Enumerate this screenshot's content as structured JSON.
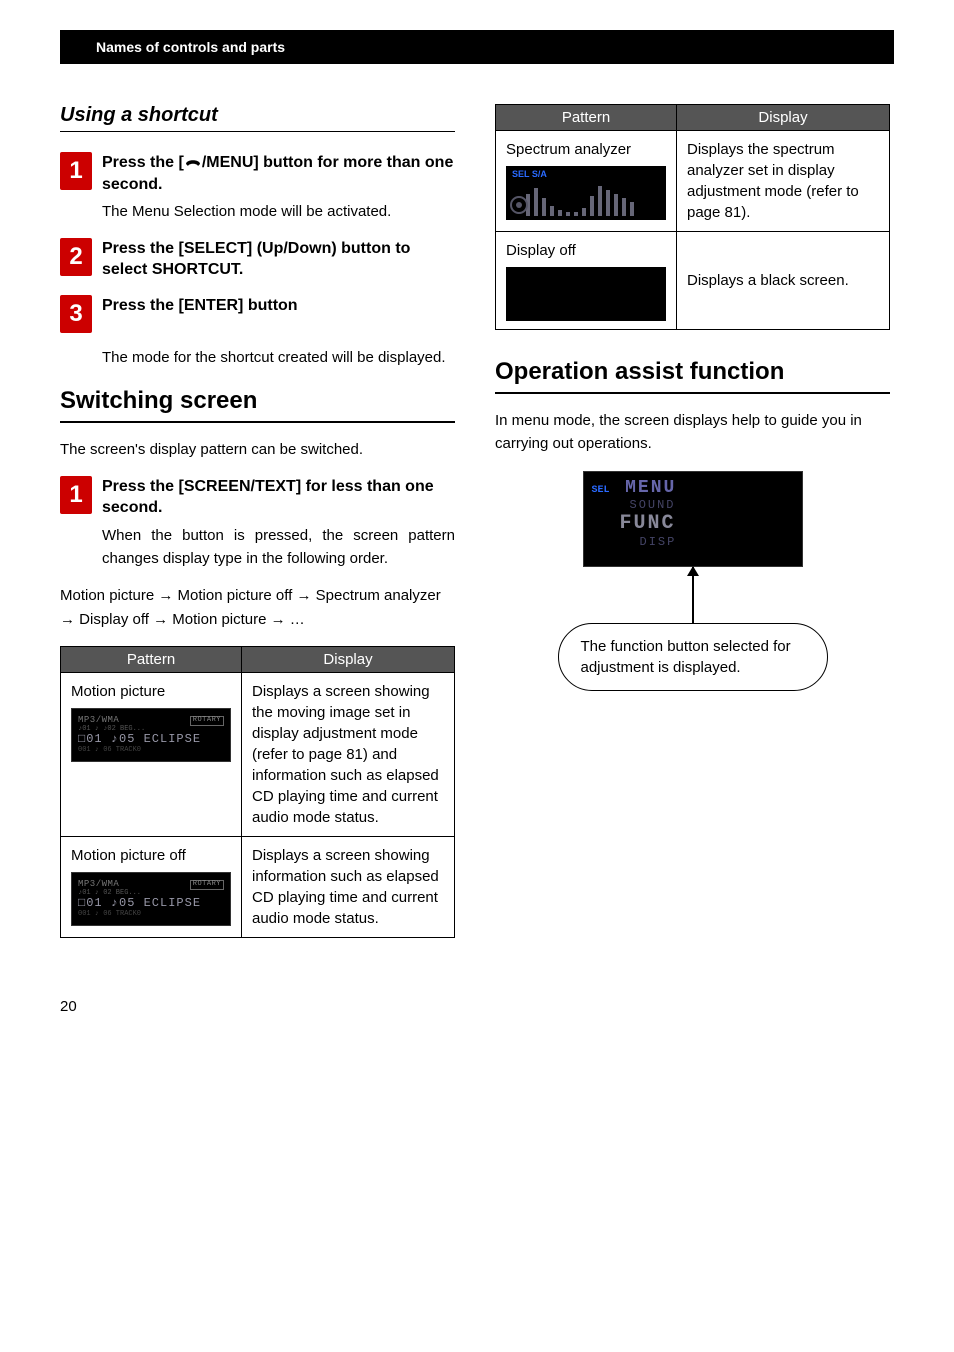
{
  "header": {
    "section_title": "Names of controls and parts"
  },
  "left": {
    "shortcut_heading": "Using a shortcut",
    "steps": [
      {
        "num": "1",
        "title_prefix": "Press the [",
        "title_mid": "/MENU] button for more than one second.",
        "desc": "The Menu Selection mode will be activated."
      },
      {
        "num": "2",
        "title": "Press the [SELECT] (Up/Down) button to select SHORTCUT.",
        "desc": ""
      },
      {
        "num": "3",
        "title": "Press the [ENTER] button",
        "desc": ""
      }
    ],
    "step3_followup": "The mode for the shortcut created will be displayed.",
    "switching_heading": "Switching screen",
    "switching_intro": "The screen's display pattern can be switched.",
    "switch_step": {
      "num": "1",
      "title": "Press the [SCREEN/TEXT] for less than one second.",
      "desc": "When the button is pressed, the screen pattern changes display type in the following order."
    },
    "flow": "Motion picture → Motion picture off → Spectrum analyzer → Display off → Motion picture → …",
    "table": {
      "headers": [
        "Pattern",
        "Display"
      ],
      "rows": [
        {
          "pattern_label": "Motion picture",
          "screen": {
            "line1_left": "MP3/WMA",
            "line1_right": "ROTARY",
            "line_main": "□01 ♪05 ECLIPSE"
          },
          "display": "Displays a screen showing the moving image set in display adjustment mode (refer to page 81) and information such as elapsed CD playing time and current audio mode status."
        },
        {
          "pattern_label": "Motion picture off",
          "screen": {
            "line1_left": "MP3/WMA",
            "line1_right": "ROTARY",
            "line_main": "□01 ♪05 ECLIPSE"
          },
          "display": "Displays a screen showing information such as elapsed CD playing time and current audio mode status."
        }
      ]
    }
  },
  "right": {
    "table": {
      "headers": [
        "Pattern",
        "Display"
      ],
      "rows": [
        {
          "pattern_label": "Spectrum analyzer",
          "sa_label": "SEL  S/A",
          "display": "Displays the spectrum analyzer set in display adjustment mode (refer to page 81)."
        },
        {
          "pattern_label": "Display off",
          "display": "Displays a black screen."
        }
      ]
    },
    "assist_heading": "Operation assist function",
    "assist_intro": "In menu mode, the screen displays help to guide you in carrying out operations.",
    "menu_screen": {
      "sel": "SEL",
      "menu": "MENU",
      "sound": "SOUND",
      "func": "FUNC",
      "disp": "DISP"
    },
    "callout": "The function button selected for adjustment is displayed."
  },
  "footer": {
    "page_number": "20"
  }
}
